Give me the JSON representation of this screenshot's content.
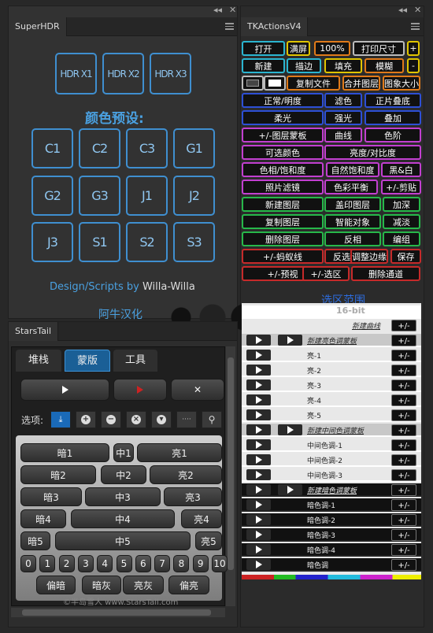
{
  "superhdr": {
    "tab": "SuperHDR",
    "hdr": [
      "HDR X1",
      "HDR X2",
      "HDR X3"
    ],
    "preset_title": "颜色预设:",
    "presets": [
      "C1",
      "C2",
      "C3",
      "G1",
      "G2",
      "G3",
      "J1",
      "J2",
      "J3",
      "S1",
      "S2",
      "S3"
    ],
    "credit_prefix": "Design/Scripts by ",
    "credit_name": "Willa-Willa"
  },
  "tk": {
    "tab": "TKActionsV4",
    "rows": [
      [
        "打开",
        "满屏",
        "100%",
        "打印尺寸",
        "+"
      ],
      [
        "新建",
        "描边",
        "填充",
        "模糊",
        "-"
      ],
      [
        "复制文件",
        "合并图层",
        "图象大小"
      ],
      [
        "正常/明度",
        "滤色",
        "正片叠底"
      ],
      [
        "柔光",
        "强光",
        "叠加"
      ],
      [
        "+/-图层蒙板",
        "曲线",
        "色阶"
      ],
      [
        "可选颜色",
        "亮度/对比度"
      ],
      [
        "色相/饱和度",
        "自然饱和度",
        "黑&白"
      ],
      [
        "照片滤镜",
        "色彩平衡",
        "+/-剪贴"
      ],
      [
        "新建图层",
        "盖印图层",
        "加深"
      ],
      [
        "复制图层",
        "智能对象",
        "减淡"
      ],
      [
        "删除图层",
        "反相",
        "编组"
      ],
      [
        "+/-蚂蚁线",
        "反选",
        "调整边缘",
        "保存"
      ],
      [
        "+/-预视",
        "+/-选区",
        "删除通道"
      ]
    ],
    "overlay": [
      "阿牛汉化",
      "选区范围",
      "色阶",
      "通道",
      "16-bit"
    ]
  },
  "actions": {
    "header": "新建曲线",
    "rows": [
      {
        "label": "新建亮色调蒙板",
        "type": "set"
      },
      {
        "label": "亮-1",
        "type": "item"
      },
      {
        "label": "亮-2",
        "type": "item"
      },
      {
        "label": "亮-3",
        "type": "item"
      },
      {
        "label": "亮-4",
        "type": "item"
      },
      {
        "label": "亮-5",
        "type": "item"
      },
      {
        "label": "新建中间色调蒙板",
        "type": "set2"
      },
      {
        "label": "中间色调-1",
        "type": "item2"
      },
      {
        "label": "中间色调-2",
        "type": "item2"
      },
      {
        "label": "中间色调-3",
        "type": "item2"
      },
      {
        "label": "新建暗色调蒙板",
        "type": "dset"
      },
      {
        "label": "暗色调-1",
        "type": "dark"
      },
      {
        "label": "暗色调-2",
        "type": "dark"
      },
      {
        "label": "暗色调-3",
        "type": "dark"
      },
      {
        "label": "暗色调-4",
        "type": "dark"
      },
      {
        "label": "暗色调",
        "type": "dark"
      }
    ],
    "pm": "+/-"
  },
  "stars": {
    "tab": "StarsTail",
    "tabs": [
      "堆栈",
      "蒙版",
      "工具"
    ],
    "options_label": "选项:",
    "rows": [
      [
        "暗1",
        "中1",
        "亮1"
      ],
      [
        "暗2",
        "中2",
        "亮2"
      ],
      [
        "暗3",
        "中3",
        "亮3"
      ],
      [
        "暗4",
        "中4",
        "亮4"
      ],
      [
        "暗5",
        "中5",
        "亮5"
      ]
    ],
    "digits": [
      "0",
      "1",
      "2",
      "3",
      "4",
      "5",
      "6",
      "7",
      "8",
      "9",
      "10"
    ],
    "bottom": [
      "偏暗",
      "暗灰",
      "亮灰",
      "偏亮"
    ],
    "footer": "©半岛雪人 www.StarsTail.com"
  }
}
